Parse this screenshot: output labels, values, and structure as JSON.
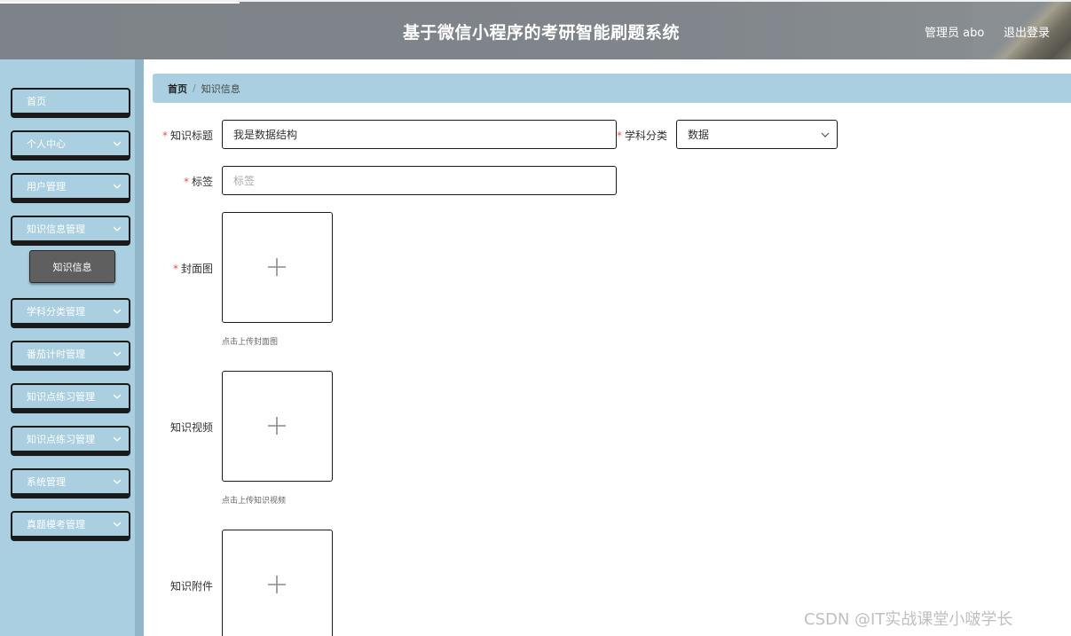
{
  "header": {
    "title": "基于微信小程序的考研智能刷题系统",
    "user": "管理员 abo",
    "logout": "退出登录"
  },
  "sidebar": {
    "items": [
      {
        "label": "首页",
        "has_arrow": false
      },
      {
        "label": "个人中心",
        "has_arrow": true
      },
      {
        "label": "用户管理",
        "has_arrow": true
      },
      {
        "label": "知识信息管理",
        "has_arrow": true
      },
      {
        "label": "学科分类管理",
        "has_arrow": true
      },
      {
        "label": "番茄计时管理",
        "has_arrow": true
      },
      {
        "label": "知识点练习管理",
        "has_arrow": true
      },
      {
        "label": "知识点练习管理",
        "has_arrow": true
      },
      {
        "label": "系统管理",
        "has_arrow": true
      },
      {
        "label": "真题模考管理",
        "has_arrow": true
      }
    ],
    "submenu": {
      "label": "知识信息"
    }
  },
  "breadcrumb": {
    "home": "首页",
    "separator": "/",
    "current": "知识信息"
  },
  "form": {
    "title_label": "知识标题",
    "title_value": "我是数据结构",
    "subject_label": "学科分类",
    "subject_value": "数据",
    "tag_label": "标签",
    "tag_placeholder": "标签",
    "cover_label": "封面图",
    "cover_hint": "点击上传封面图",
    "video_label": "知识视频",
    "video_hint": "点击上传知识视频",
    "attachment_label": "知识附件",
    "required_mark": "*"
  },
  "watermark": "CSDN @IT实战课堂小啵学长",
  "colors": {
    "header_bg": "#7f858a",
    "sidebar_bg": "#a9cfe0",
    "active_submenu": "#5f5f5f",
    "required": "#e25555"
  }
}
